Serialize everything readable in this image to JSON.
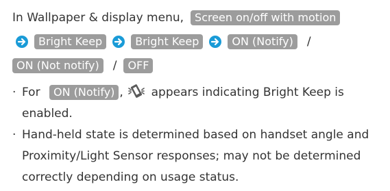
{
  "instruction": {
    "intro": "In Wallpaper & display menu,",
    "steps": [
      "Screen on/off with motion",
      "Bright Keep",
      "Bright Keep",
      "ON (Notify)",
      "ON (Not notify)",
      "OFF"
    ],
    "separator": "/"
  },
  "notes": {
    "bullet": "·",
    "note1": {
      "prefix": "For",
      "pill": "ON (Notify)",
      "comma": ",",
      "suffix": "appears indicating Bright Keep is enabled."
    },
    "note2": {
      "text": "Hand-held state is determined based on handset angle and Proximity/Light Sensor responses; may not be determined correctly depending on usage status."
    }
  },
  "colors": {
    "pill_bg": "#9c9c9c",
    "arrow": "#1a9bd7",
    "text": "#333333",
    "icon": "#5a5a5a"
  },
  "icons": {
    "step_arrow": "right-arrow-circle-icon",
    "status": "bright-keep-status-icon"
  }
}
